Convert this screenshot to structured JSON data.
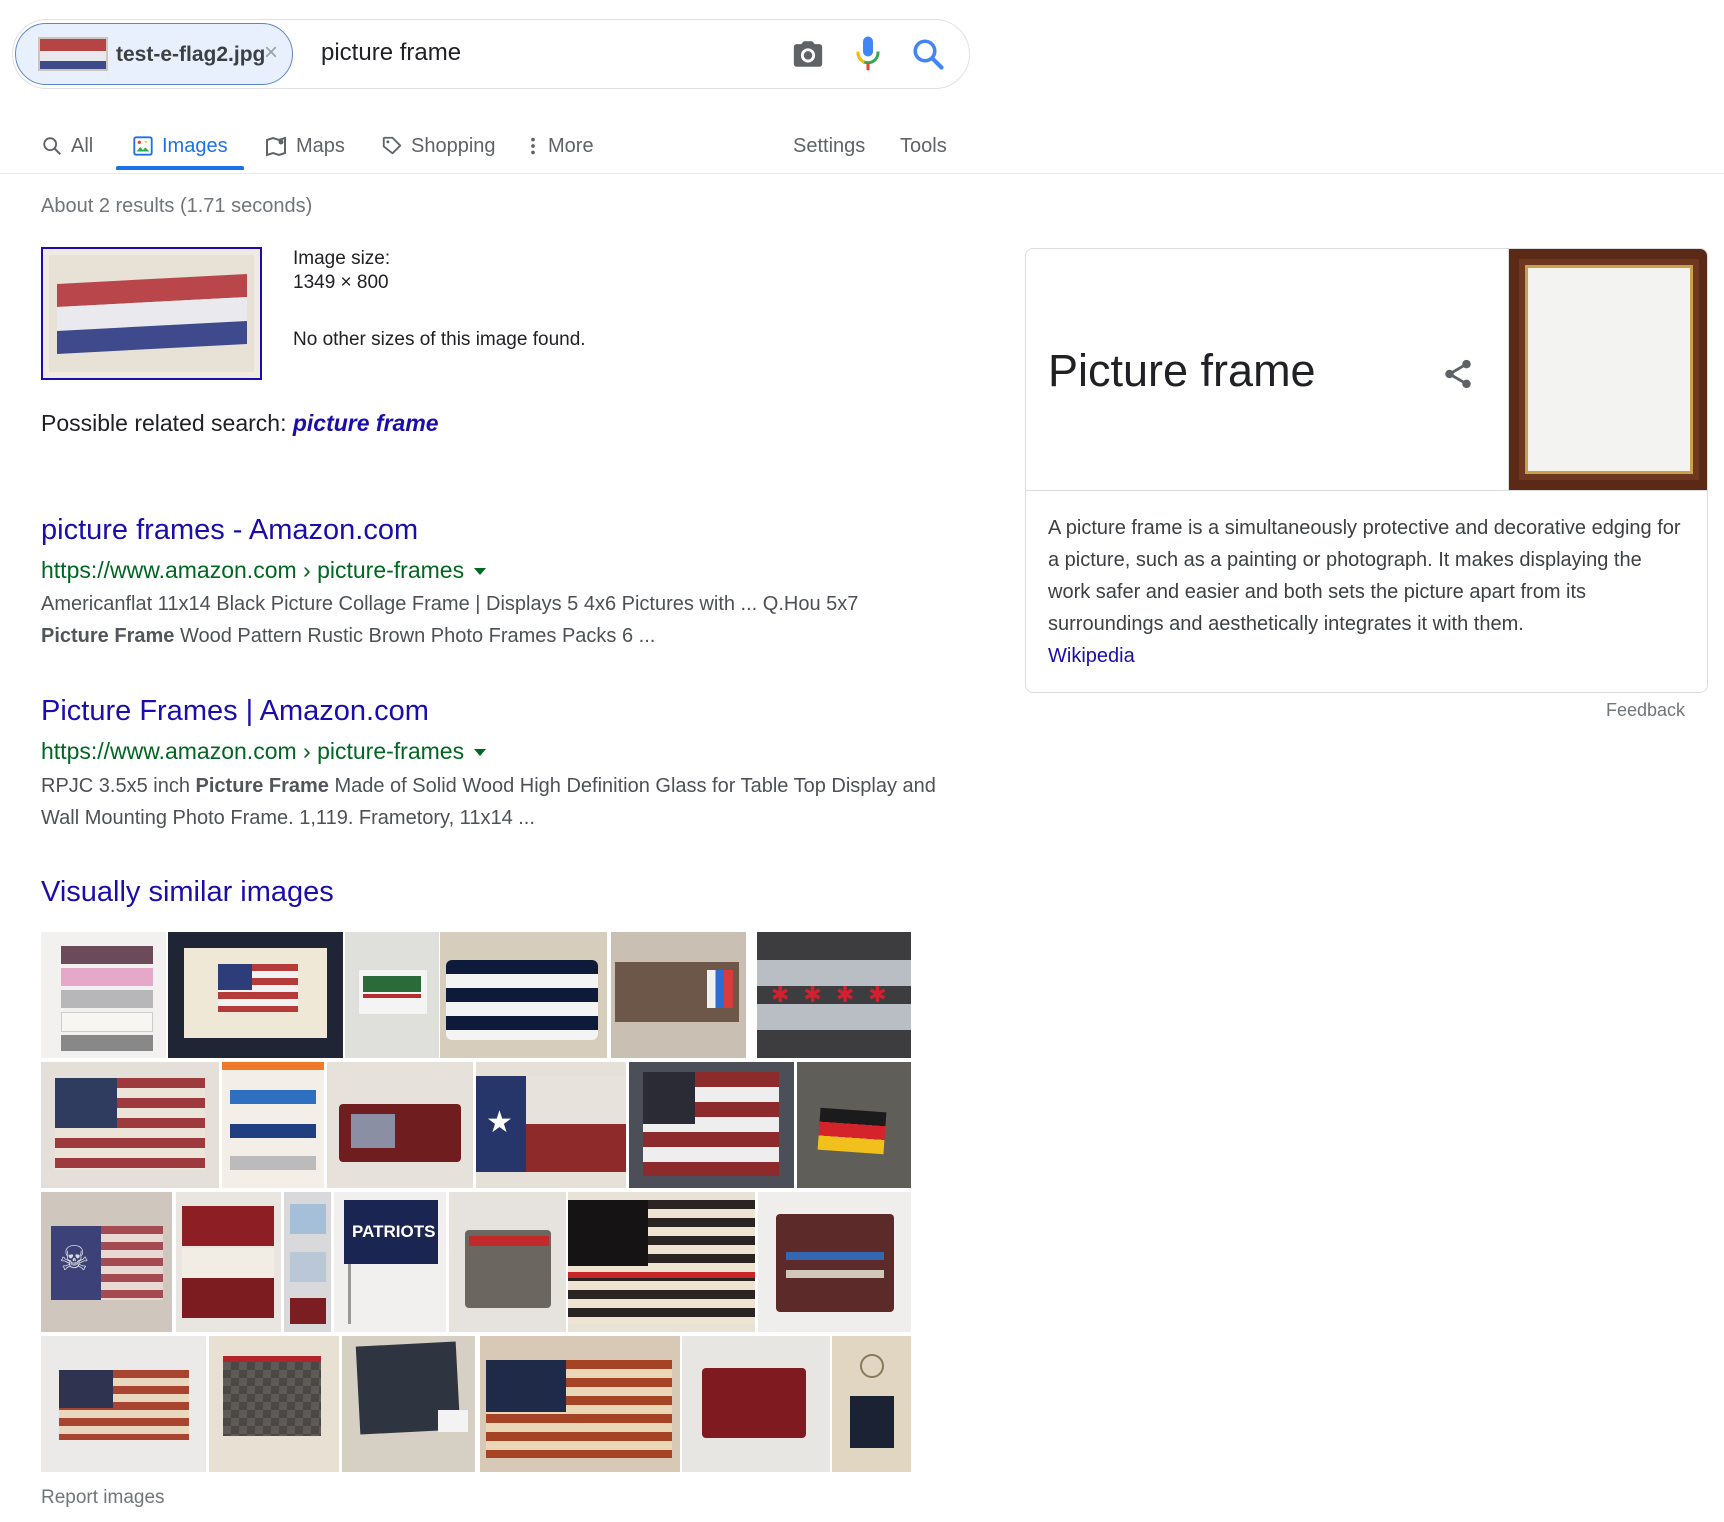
{
  "search": {
    "image_chip_name": "test-e-flag2.jpg",
    "chip_close": "×",
    "query": "picture frame"
  },
  "tabs": [
    {
      "label": "All",
      "icon": "search-icon",
      "active": false
    },
    {
      "label": "Images",
      "icon": "image-icon",
      "active": true
    },
    {
      "label": "Maps",
      "icon": "map-icon",
      "active": false
    },
    {
      "label": "Shopping",
      "icon": "tag-icon",
      "active": false
    },
    {
      "label": "More",
      "icon": "more-vert-icon",
      "active": false
    },
    {
      "label": "Settings",
      "active": false
    },
    {
      "label": "Tools",
      "active": false
    }
  ],
  "results": {
    "stats": "About 2 results (1.71 seconds)",
    "image_size_label": "Image size:",
    "image_size_value": "1349 × 800",
    "no_other_sizes": "No other sizes of this image found.",
    "related_prefix": "Possible related search:",
    "related_query": "picture frame",
    "items": [
      {
        "title": "picture frames - Amazon.com",
        "url": "https://www.amazon.com › picture-frames",
        "snippet_a": "Americanflat 11x14 Black Picture Collage Frame | Displays 5 4x6 Pictures with ... Q.Hou 5x7",
        "snippet_bold": "Picture Frame",
        "snippet_b": " Wood Pattern Rustic Brown Photo Frames Packs 6 ..."
      },
      {
        "title": "Picture Frames | Amazon.com",
        "url": "https://www.amazon.com › picture-frames",
        "snippet_a": "RPJC 3.5x5 inch ",
        "snippet_bold": "Picture Frame",
        "snippet_b": " Made of Solid Wood High Definition Glass for Table Top Display and Wall Mounting Photo Frame. 1,119. Frametory, 11x14 ..."
      }
    ],
    "visually_similar_title": "Visually similar images",
    "report": "Report images"
  },
  "knowledge_panel": {
    "title": "Picture frame",
    "description": "A picture frame is a simultaneously protective and decorative edging for a picture, such as a painting or photograph. It makes displaying the work safer and easier and both sets the picture apart from its surroundings and aesthetically integrates it with them.",
    "source": "Wikipedia",
    "feedback": "Feedback"
  },
  "colors": {
    "accent_blue": "#1a73e8",
    "link": "#1a0dab",
    "url_green": "#006621"
  }
}
